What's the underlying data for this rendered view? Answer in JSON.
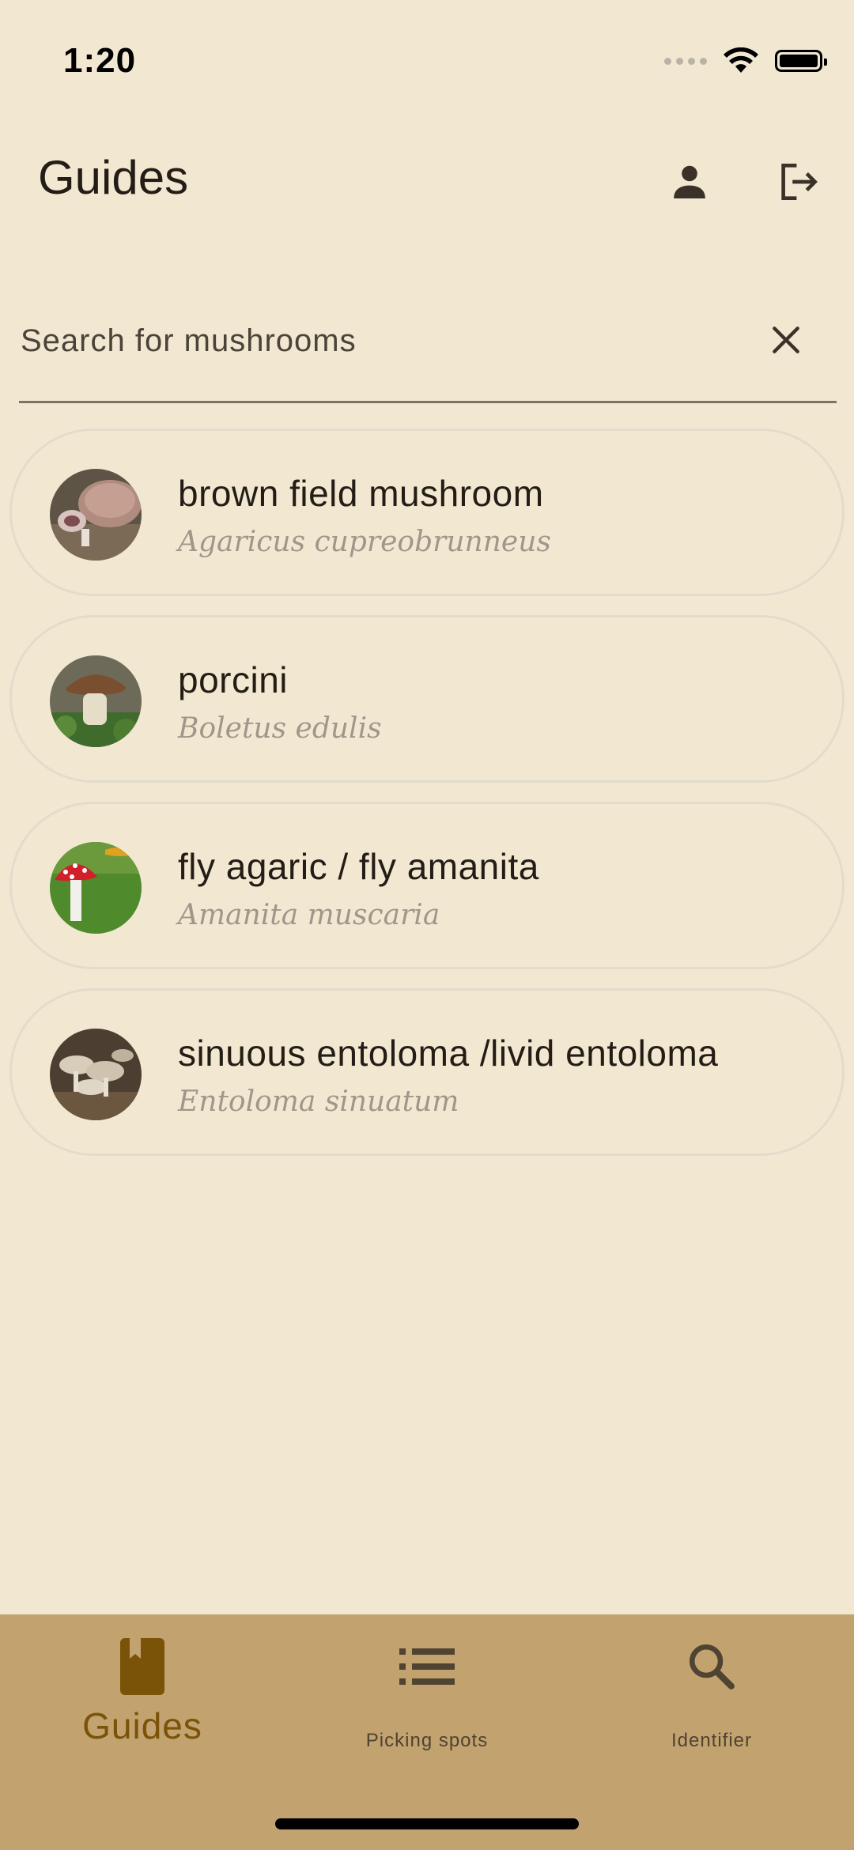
{
  "status_bar": {
    "time": "1:20"
  },
  "header": {
    "title": "Guides",
    "profile_icon": "person-icon",
    "logout_icon": "logout-icon"
  },
  "search": {
    "placeholder": "Search for mushrooms",
    "value": "",
    "clear_icon": "close-icon"
  },
  "mushrooms": [
    {
      "name": "brown field mushroom",
      "latin": "Agaricus cupreobrunneus"
    },
    {
      "name": "porcini",
      "latin": "Boletus edulis"
    },
    {
      "name": "fly agaric / fly amanita",
      "latin": "Amanita muscaria"
    },
    {
      "name": "sinuous entoloma /livid entoloma",
      "latin": "Entoloma sinuatum"
    }
  ],
  "bottom_nav": {
    "items": [
      {
        "label": "Guides",
        "icon": "book-icon",
        "active": true
      },
      {
        "label": "Picking spots",
        "icon": "list-icon",
        "active": false
      },
      {
        "label": "Identifier",
        "icon": "search-icon",
        "active": false
      }
    ]
  },
  "colors": {
    "background": "#f2e8d2",
    "nav_background": "#c2a26f",
    "nav_active": "#7a5208",
    "latin_text": "#9e978a"
  }
}
